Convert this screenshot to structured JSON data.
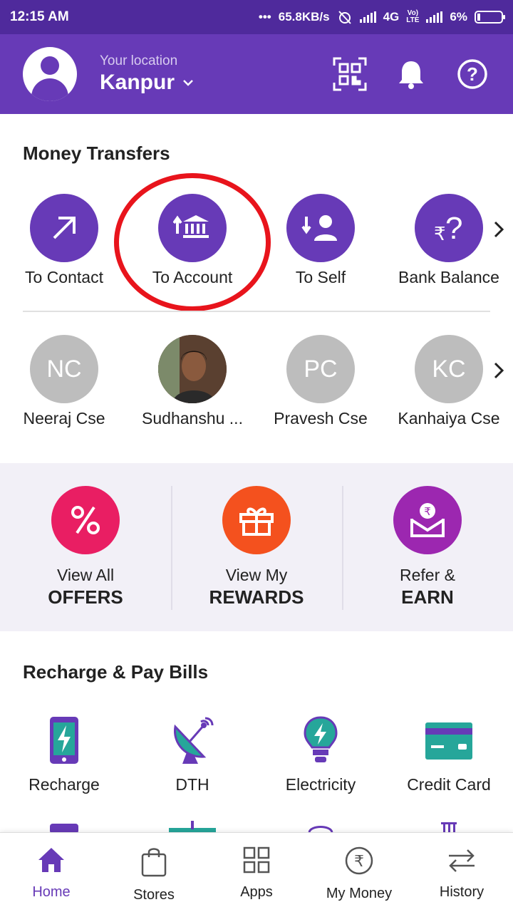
{
  "status_bar": {
    "time": "12:15 AM",
    "dots": "•••",
    "speed": "65.8KB/s",
    "network": "4G",
    "volte": "VoLTE",
    "battery": "6%"
  },
  "header": {
    "location_label": "Your location",
    "city": "Kanpur",
    "icons": [
      "qr-scan-icon",
      "bell-icon",
      "help-icon"
    ]
  },
  "money_transfers": {
    "title": "Money Transfers",
    "actions": [
      {
        "label": "To Contact",
        "icon": "arrow-up-right-icon"
      },
      {
        "label": "To Account",
        "icon": "bank-icon"
      },
      {
        "label": "To Self",
        "icon": "person-arrow-icon"
      },
      {
        "label": "Bank Balance",
        "icon": "rupee-question-icon"
      }
    ],
    "contacts": [
      {
        "initials": "NC",
        "name": "Neeraj Cse"
      },
      {
        "initials": "",
        "name": "Sudhanshu ..."
      },
      {
        "initials": "PC",
        "name": "Pravesh Cse"
      },
      {
        "initials": "KC",
        "name": "Kanhaiya Cse"
      }
    ]
  },
  "promos": [
    {
      "line1": "View All",
      "line2": "OFFERS",
      "color": "#e91e63",
      "icon": "percent-icon"
    },
    {
      "line1": "View My",
      "line2": "REWARDS",
      "color": "#f4511e",
      "icon": "gift-icon"
    },
    {
      "line1": "Refer &",
      "line2": "EARN",
      "color": "#9c27b0",
      "icon": "envelope-rupee-icon"
    }
  ],
  "recharge": {
    "title": "Recharge & Pay Bills",
    "items": [
      {
        "label": "Recharge",
        "icon": "mobile-icon"
      },
      {
        "label": "DTH",
        "icon": "satellite-dish-icon"
      },
      {
        "label": "Electricity",
        "icon": "bulb-icon"
      },
      {
        "label": "Credit Card",
        "icon": "credit-card-icon"
      }
    ]
  },
  "bottom_nav": [
    {
      "label": "Home",
      "icon": "home-icon",
      "active": true
    },
    {
      "label": "Stores",
      "icon": "shopping-bag-icon"
    },
    {
      "label": "Apps",
      "icon": "apps-grid-icon"
    },
    {
      "label": "My Money",
      "icon": "rupee-circle-icon"
    },
    {
      "label": "History",
      "icon": "swap-arrows-icon"
    }
  ],
  "colors": {
    "primary": "#673ab7",
    "status_bar": "#4f2a9c",
    "highlight": "#e8141c",
    "teal": "#26a69a"
  }
}
